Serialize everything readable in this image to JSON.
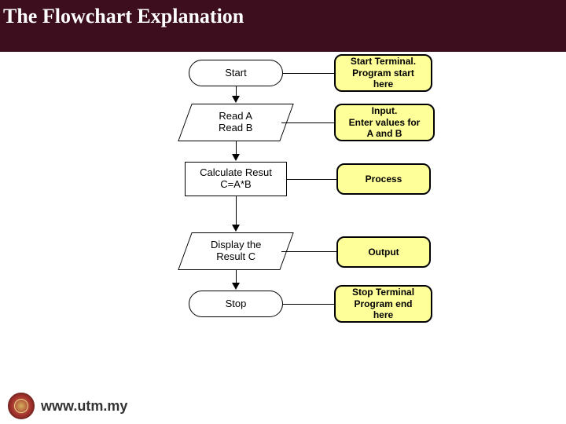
{
  "title": "The Flowchart Explanation",
  "flowchart": {
    "nodes": {
      "start": "Start",
      "read": "Read A\nRead B",
      "calc": "Calculate Resut\nC=A*B",
      "display": "Display the\nResult C",
      "stop": "Stop"
    }
  },
  "callouts": {
    "start": "Start Terminal.\nProgram start\nhere",
    "input": "Input.\nEnter values for\nA and B",
    "process": "Process",
    "output": "Output",
    "stop": "Stop Terminal\nProgram end\nhere"
  },
  "footer": {
    "url": "www.utm.my"
  }
}
